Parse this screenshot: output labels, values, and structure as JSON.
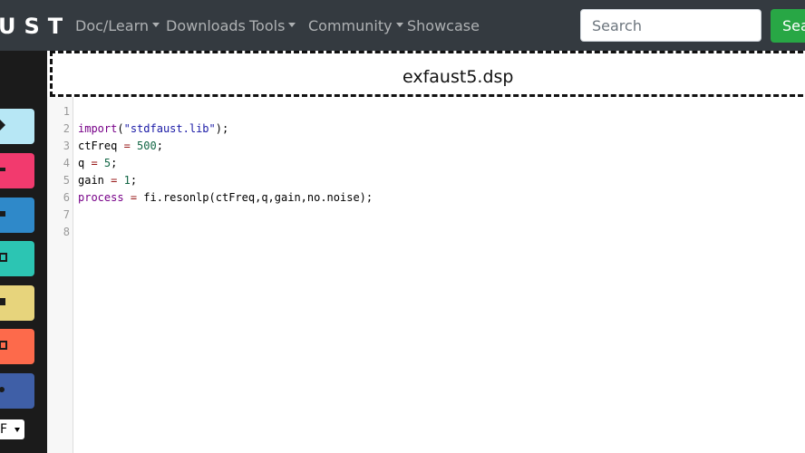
{
  "navbar": {
    "brand": "UST",
    "items": [
      {
        "label": "Doc/Learn",
        "dropdown": true
      },
      {
        "label": "Downloads",
        "dropdown": false
      },
      {
        "label": "Tools",
        "dropdown": true
      },
      {
        "label": "Community",
        "dropdown": true
      },
      {
        "label": "Showcase",
        "dropdown": false
      }
    ],
    "search_placeholder": "Search",
    "search_button_label": "Sea"
  },
  "sidebar": {
    "tools": [
      {
        "name": "run",
        "color": "#b7e7f5"
      },
      {
        "name": "share",
        "color": "#f23a6e"
      },
      {
        "name": "export",
        "color": "#2f89c9"
      },
      {
        "name": "diagram",
        "color": "#2cc5b3"
      },
      {
        "name": "save",
        "color": "#e7d47c"
      },
      {
        "name": "image",
        "color": "#fd6a4b"
      },
      {
        "name": "settings",
        "color": "#3f5fa7"
      }
    ],
    "lang_select_value": "F"
  },
  "editor": {
    "filename": "exfaust5.dsp",
    "line_numbers": [
      "1",
      "2",
      "3",
      "4",
      "5",
      "6",
      "7",
      "8"
    ],
    "lines": [
      [],
      [
        {
          "t": "import",
          "c": "tok-kw"
        },
        {
          "t": "(",
          "c": ""
        },
        {
          "t": "\"stdfaust.lib\"",
          "c": "tok-str2"
        },
        {
          "t": ");",
          "c": ""
        }
      ],
      [
        {
          "t": "ctFreq ",
          "c": ""
        },
        {
          "t": "=",
          "c": "tok-op"
        },
        {
          "t": " ",
          "c": ""
        },
        {
          "t": "500",
          "c": "tok-num"
        },
        {
          "t": ";",
          "c": ""
        }
      ],
      [
        {
          "t": "q ",
          "c": ""
        },
        {
          "t": "=",
          "c": "tok-op"
        },
        {
          "t": " ",
          "c": ""
        },
        {
          "t": "5",
          "c": "tok-num"
        },
        {
          "t": ";",
          "c": ""
        }
      ],
      [
        {
          "t": "gain ",
          "c": ""
        },
        {
          "t": "=",
          "c": "tok-op"
        },
        {
          "t": " ",
          "c": ""
        },
        {
          "t": "1",
          "c": "tok-num"
        },
        {
          "t": ";",
          "c": ""
        }
      ],
      [
        {
          "t": "process",
          "c": "tok-kw"
        },
        {
          "t": " ",
          "c": ""
        },
        {
          "t": "=",
          "c": "tok-op"
        },
        {
          "t": " fi.resonlp(ctFreq,q,gain,no.noise);",
          "c": ""
        }
      ],
      [],
      []
    ]
  },
  "colors": {
    "navbar_bg": "#343a40",
    "search_button": "#28a745",
    "keyword": "#770088",
    "string": "#1a1aa6",
    "number": "#116644"
  }
}
